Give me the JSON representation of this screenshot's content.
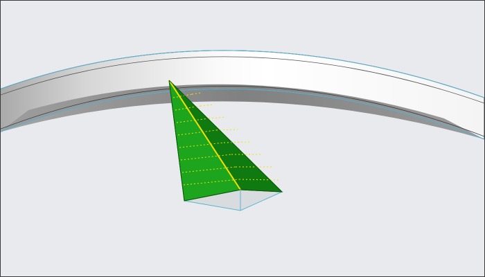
{
  "viewport": {
    "background": "#e8eaed",
    "border": "#3a3a3a"
  },
  "ring": {
    "shape": "curved-band",
    "face_color": "#ffffff",
    "shadow_color": "#7a7a7a",
    "edge_highlight": "#5ab4d6"
  },
  "pyramid": {
    "shape": "pyramid",
    "selected_face_color": "#1ea51e",
    "dark_face_color": "#0f7a0f",
    "base_color": "#d9dcdf",
    "selected_edge_color": "#f2e200",
    "hatch_color": "#f2e200",
    "edge_highlight": "#5ab4d6"
  }
}
